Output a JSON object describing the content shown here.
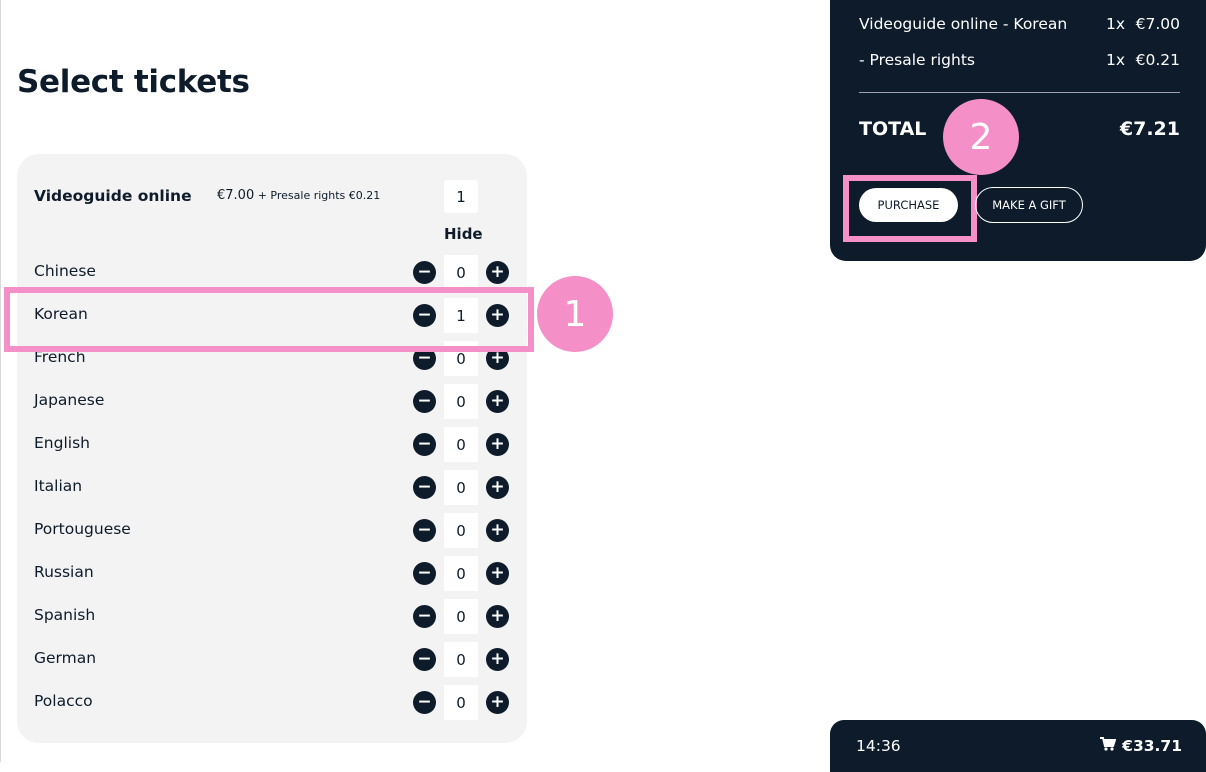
{
  "page": {
    "title": "Select tickets"
  },
  "ticket": {
    "name": "Videoguide online",
    "price": "€7.00",
    "price_extra": " + Presale rights €0.21",
    "quantity": "1",
    "hide_label": "Hide",
    "languages": [
      {
        "label": "Chinese",
        "count": "0"
      },
      {
        "label": "Korean",
        "count": "1"
      },
      {
        "label": "French",
        "count": "0"
      },
      {
        "label": "Japanese",
        "count": "0"
      },
      {
        "label": "English",
        "count": "0"
      },
      {
        "label": "Italian",
        "count": "0"
      },
      {
        "label": "Portouguese",
        "count": "0"
      },
      {
        "label": "Russian",
        "count": "0"
      },
      {
        "label": "Spanish",
        "count": "0"
      },
      {
        "label": "German",
        "count": "0"
      },
      {
        "label": "Polacco",
        "count": "0"
      }
    ]
  },
  "stepper": {
    "minus": "−",
    "plus": "+"
  },
  "annotations": {
    "step1": "1",
    "step2": "2"
  },
  "summary": {
    "lines": [
      {
        "label": "Videoguide online - Korean",
        "qty": "1x",
        "amount": "€7.00"
      },
      {
        "label": "- Presale rights",
        "qty": "1x",
        "amount": "€0.21"
      }
    ],
    "total_label": "TOTAL",
    "total_value": "€7.21",
    "purchase_label": "PURCHASE",
    "gift_label": "MAKE A GIFT"
  },
  "mini_cart": {
    "time": "14:36",
    "total": "€33.71",
    "icon": "cart-icon"
  },
  "colors": {
    "navy": "#0d1b2a",
    "highlight_pink": "#f48fc8",
    "card_bg": "#f3f3f3"
  }
}
